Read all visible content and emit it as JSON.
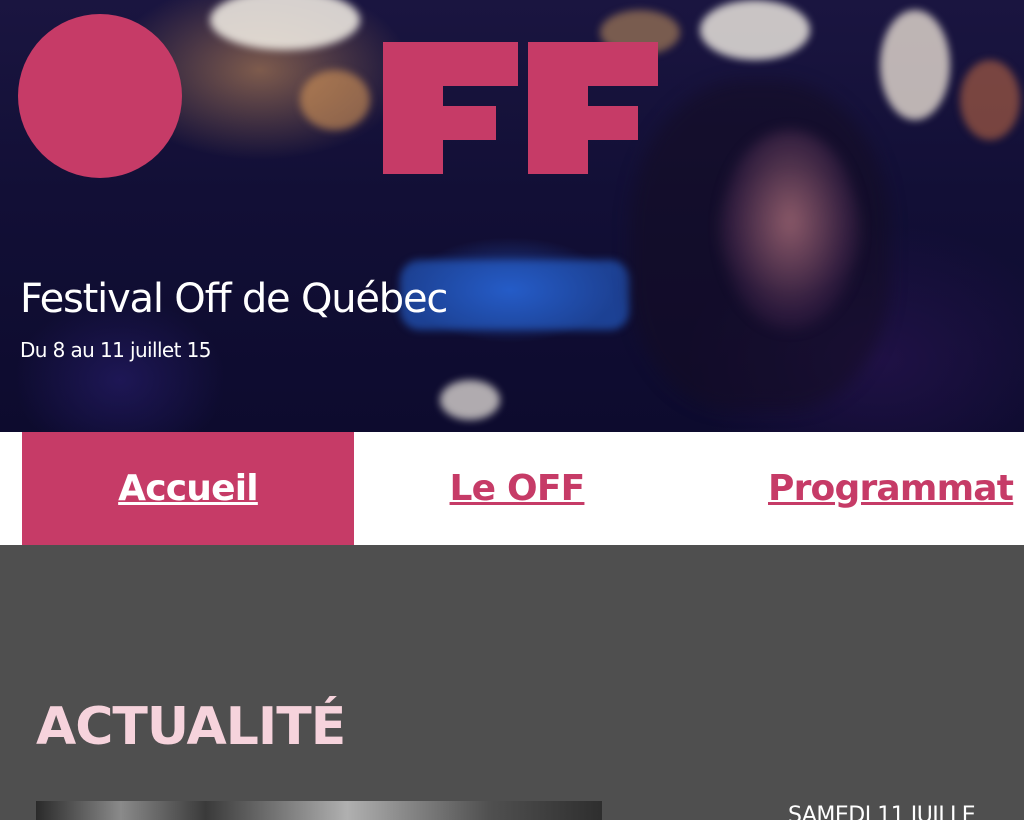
{
  "header": {
    "logo_text": "OFF",
    "title": "Festival Off de Québec",
    "dates": "Du 8 au 11 juillet 15"
  },
  "nav": {
    "items": [
      {
        "label": "Accueil",
        "active": true
      },
      {
        "label": "Le OFF",
        "active": false
      },
      {
        "label": "Programmat",
        "active": false
      }
    ]
  },
  "main": {
    "section_title": "ACTUALITÉ",
    "news": [
      {
        "date": "SAMEDI 11 JUILLE"
      }
    ]
  },
  "colors": {
    "brand_pink": "#c63b67",
    "section_title_pink": "#f6d3dc",
    "main_background": "#4f4f4f",
    "nav_background": "#ffffff"
  }
}
